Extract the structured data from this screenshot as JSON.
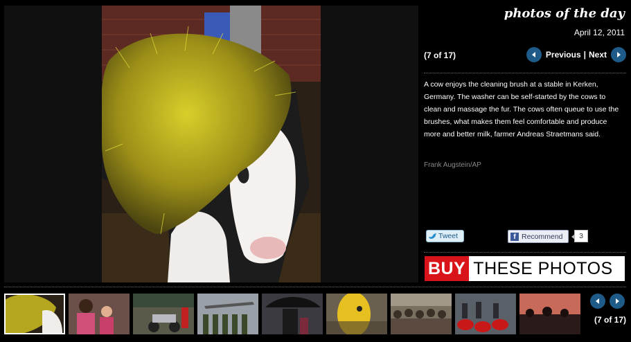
{
  "main_photo": {
    "alt": "A cow enjoys the cleaning brush at a stable in Kerken"
  },
  "sidebar": {
    "section_title": "photos of the day",
    "date": "April 12, 2011",
    "counter": "(7 of 17)",
    "previous_label": "Previous",
    "separator": "|",
    "next_label": "Next",
    "caption": "A cow enjoys the cleaning brush at a stable in Kerken, Germany. The washer can be self-started by the cows to clean and massage the fur. The cows often queue to use the brushes, what makes them feel comfortable and produce more and better milk, farmer Andreas Straetmans said.",
    "credit": "Frank Augstein/AP",
    "tweet_label": "Tweet",
    "recommend_label": "Recommend",
    "recommend_count": "3",
    "buy_label": "BUY",
    "buy_rest": "THESE PHOTOS"
  },
  "thumbnails": [
    {
      "name": "cow-brush",
      "active": true
    },
    {
      "name": "girls",
      "active": false
    },
    {
      "name": "scooter",
      "active": false
    },
    {
      "name": "soldiers-aircraft",
      "active": false
    },
    {
      "name": "man-umbrella",
      "active": false
    },
    {
      "name": "yellow-mascot",
      "active": false
    },
    {
      "name": "crowd",
      "active": false
    },
    {
      "name": "red-boats",
      "active": false
    },
    {
      "name": "sunset-crowd",
      "active": false
    }
  ],
  "strip": {
    "counter": "(7 of 17)"
  },
  "colors": {
    "nav_button": "#1e5b88",
    "buy_red": "#d8141a"
  }
}
